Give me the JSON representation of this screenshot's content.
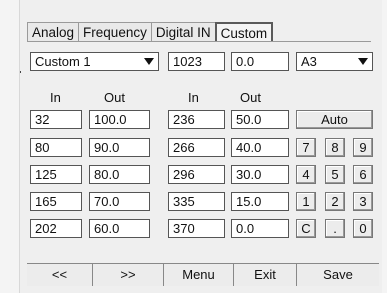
{
  "tabs": [
    "Analog",
    "Frequency",
    "Digital IN",
    "Custom"
  ],
  "active_tab": "Custom",
  "controls": {
    "curve_select": "Custom 1",
    "value1": "1023",
    "value2": "0.0",
    "pin_select": "A3"
  },
  "headers": {
    "in": "In",
    "out": "Out"
  },
  "table_left": [
    {
      "in": "32",
      "out": "100.0"
    },
    {
      "in": "80",
      "out": "90.0"
    },
    {
      "in": "125",
      "out": "80.0"
    },
    {
      "in": "165",
      "out": "70.0"
    },
    {
      "in": "202",
      "out": "60.0"
    }
  ],
  "table_right": [
    {
      "in": "236",
      "out": "50.0"
    },
    {
      "in": "266",
      "out": "40.0"
    },
    {
      "in": "296",
      "out": "30.0"
    },
    {
      "in": "335",
      "out": "15.0"
    },
    {
      "in": "370",
      "out": "0.0"
    }
  ],
  "auto_label": "Auto",
  "keypad": [
    [
      "7",
      "8",
      "9"
    ],
    [
      "4",
      "5",
      "6"
    ],
    [
      "1",
      "2",
      "3"
    ],
    [
      "C",
      ".",
      "0"
    ]
  ],
  "bottom": {
    "prev": "<<",
    "next": ">>",
    "menu": "Menu",
    "exit": "Exit",
    "save": "Save"
  }
}
